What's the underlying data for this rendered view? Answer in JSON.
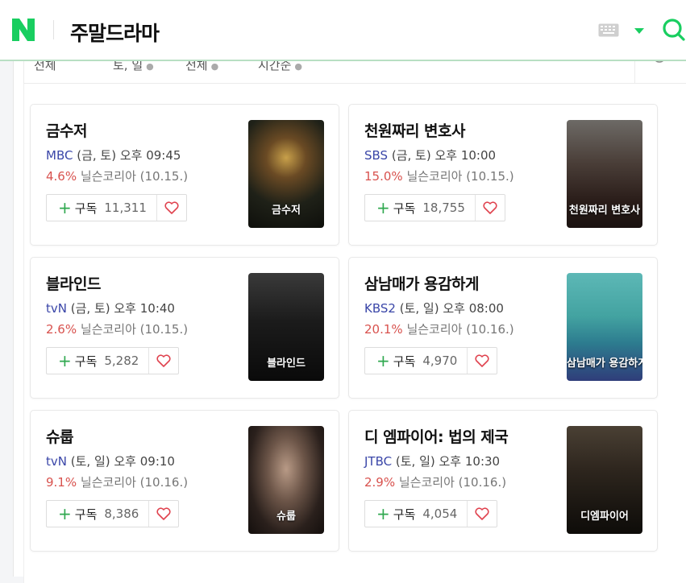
{
  "header": {
    "logo_letter": "N",
    "title": "주말드라마",
    "brand_color": "#19ce60"
  },
  "filters": [
    {
      "label": "전체"
    },
    {
      "label": "토, 일"
    },
    {
      "label": "전체"
    },
    {
      "label": "시간순"
    }
  ],
  "dramas": [
    {
      "title": "금수저",
      "channel": "MBC",
      "schedule": "(금, 토) 오후 09:45",
      "rating": "4.6%",
      "rating_source": "닐슨코리아 (10.15.)",
      "subscribe_label": "구독",
      "subscribers": "11,311",
      "poster_text": "금수저"
    },
    {
      "title": "천원짜리 변호사",
      "channel": "SBS",
      "schedule": "(금, 토) 오후 10:00",
      "rating": "15.0%",
      "rating_source": "닐슨코리아 (10.15.)",
      "subscribe_label": "구독",
      "subscribers": "18,755",
      "poster_text": "천원짜리 변호사"
    },
    {
      "title": "블라인드",
      "channel": "tvN",
      "schedule": "(금, 토) 오후 10:40",
      "rating": "2.6%",
      "rating_source": "닐슨코리아 (10.15.)",
      "subscribe_label": "구독",
      "subscribers": "5,282",
      "poster_text": "블라인드"
    },
    {
      "title": "삼남매가 용감하게",
      "channel": "KBS2",
      "schedule": "(토, 일) 오후 08:00",
      "rating": "20.1%",
      "rating_source": "닐슨코리아 (10.16.)",
      "subscribe_label": "구독",
      "subscribers": "4,970",
      "poster_text": "삼남매가 용감하게"
    },
    {
      "title": "슈룹",
      "channel": "tvN",
      "schedule": "(토, 일) 오후 09:10",
      "rating": "9.1%",
      "rating_source": "닐슨코리아 (10.16.)",
      "subscribe_label": "구독",
      "subscribers": "8,386",
      "poster_text": "슈룹"
    },
    {
      "title": "디 엠파이어: 법의 제국",
      "channel": "JTBC",
      "schedule": "(토, 일) 오후 10:30",
      "rating": "2.9%",
      "rating_source": "닐슨코리아 (10.16.)",
      "subscribe_label": "구독",
      "subscribers": "4,054",
      "poster_text": "디엠파이어"
    }
  ]
}
